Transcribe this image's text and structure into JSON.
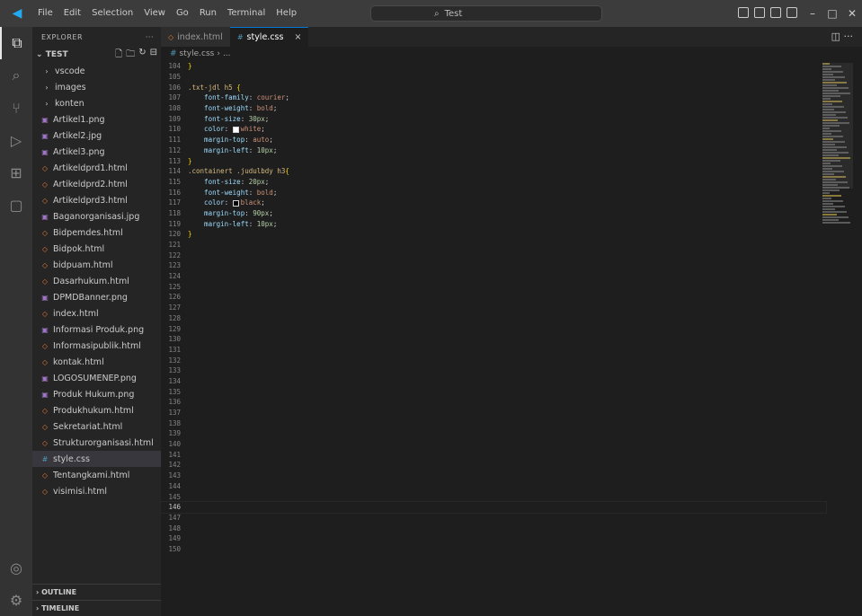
{
  "titlebar": {
    "logo": "◀",
    "menu": [
      "File",
      "Edit",
      "Selection",
      "View",
      "Go",
      "Run",
      "Terminal",
      "Help"
    ],
    "search": "Test",
    "nav_back": "←",
    "nav_forward": "→"
  },
  "activitybar": {
    "icons": [
      "explorer-icon",
      "search-icon",
      "source-control-icon",
      "run-debug-icon",
      "extensions-icon",
      "remote-explorer-icon"
    ],
    "bottom_icons": [
      "accounts-icon",
      "settings-gear-icon"
    ]
  },
  "sidebar": {
    "title": "EXPLORER",
    "more": "···",
    "root": "TEST",
    "items": [
      {
        "label": "vscode",
        "type": "folder"
      },
      {
        "label": "images",
        "type": "folder"
      },
      {
        "label": "konten",
        "type": "folder"
      },
      {
        "label": "Artikel1.png",
        "type": "img"
      },
      {
        "label": "Artikel2.jpg",
        "type": "img"
      },
      {
        "label": "Artikel3.png",
        "type": "img"
      },
      {
        "label": "Artikeldprd1.html",
        "type": "html"
      },
      {
        "label": "Artikeldprd2.html",
        "type": "html"
      },
      {
        "label": "Artikeldprd3.html",
        "type": "html"
      },
      {
        "label": "Baganorganisasi.jpg",
        "type": "img"
      },
      {
        "label": "Bidpemdes.html",
        "type": "html"
      },
      {
        "label": "Bidpok.html",
        "type": "html"
      },
      {
        "label": "bidpuam.html",
        "type": "html"
      },
      {
        "label": "Dasarhukum.html",
        "type": "html"
      },
      {
        "label": "DPMDBanner.png",
        "type": "img"
      },
      {
        "label": "index.html",
        "type": "html"
      },
      {
        "label": "Informasi Produk.png",
        "type": "img"
      },
      {
        "label": "Informasipublik.html",
        "type": "html"
      },
      {
        "label": "kontak.html",
        "type": "html"
      },
      {
        "label": "LOGOSUMENEP.png",
        "type": "img"
      },
      {
        "label": "Produk Hukum.png",
        "type": "img"
      },
      {
        "label": "Produkhukum.html",
        "type": "html"
      },
      {
        "label": "Sekretariat.html",
        "type": "html"
      },
      {
        "label": "Strukturorganisasi.html",
        "type": "html"
      },
      {
        "label": "style.css",
        "type": "css",
        "selected": true
      },
      {
        "label": "Tentangkami.html",
        "type": "html"
      },
      {
        "label": "visimisi.html",
        "type": "html"
      }
    ],
    "outline": "OUTLINE",
    "timeline": "TIMELINE"
  },
  "editor": {
    "tabs": [
      {
        "label": "index.html",
        "type": "html",
        "active": false
      },
      {
        "label": "style.css",
        "type": "css",
        "active": true,
        "close": "×"
      }
    ],
    "breadcrumb": [
      "style.css",
      "..."
    ],
    "actions": "◫ ···",
    "current_line": 146,
    "lines": [
      {
        "n": "104",
        "tokens": [
          [
            "t-brace",
            "}"
          ]
        ]
      },
      {
        "n": "105",
        "tokens": []
      },
      {
        "n": "106",
        "tokens": [
          [
            "t-sel",
            ".txt-jdl h5 "
          ],
          [
            "t-brace",
            "{"
          ]
        ]
      },
      {
        "n": "107",
        "tokens": [
          [
            "t-prop",
            "    font-family"
          ],
          [
            "t-punc",
            ": "
          ],
          [
            "t-val",
            "courier"
          ],
          [
            "t-punc",
            ";"
          ]
        ]
      },
      {
        "n": "108",
        "tokens": [
          [
            "t-prop",
            "    font-weight"
          ],
          [
            "t-punc",
            ": "
          ],
          [
            "t-val",
            "bold"
          ],
          [
            "t-punc",
            ";"
          ]
        ]
      },
      {
        "n": "109",
        "tokens": [
          [
            "t-prop",
            "    font-size"
          ],
          [
            "t-punc",
            ": "
          ],
          [
            "t-num",
            "30px"
          ],
          [
            "t-punc",
            ";"
          ]
        ]
      },
      {
        "n": "110",
        "tokens": [
          [
            "t-prop",
            "    color"
          ],
          [
            "t-punc",
            ": "
          ],
          [
            "swatch-white",
            ""
          ],
          [
            "t-val",
            "white"
          ],
          [
            "t-punc",
            ";"
          ]
        ]
      },
      {
        "n": "111",
        "tokens": [
          [
            "t-prop",
            "    margin-top"
          ],
          [
            "t-punc",
            ": "
          ],
          [
            "t-val",
            "auto"
          ],
          [
            "t-punc",
            ";"
          ]
        ]
      },
      {
        "n": "112",
        "tokens": [
          [
            "t-prop",
            "    margin-left"
          ],
          [
            "t-punc",
            ": "
          ],
          [
            "t-num",
            "10px"
          ],
          [
            "t-punc",
            ";"
          ]
        ]
      },
      {
        "n": "113",
        "tokens": [
          [
            "t-brace",
            "}"
          ]
        ]
      },
      {
        "n": "114",
        "tokens": [
          [
            "t-sel",
            ".containert .judulbdy h3"
          ],
          [
            "t-brace",
            "{"
          ]
        ]
      },
      {
        "n": "115",
        "tokens": [
          [
            "t-prop",
            "    font-size"
          ],
          [
            "t-punc",
            ": "
          ],
          [
            "t-num",
            "20px"
          ],
          [
            "t-punc",
            ";"
          ]
        ]
      },
      {
        "n": "116",
        "tokens": [
          [
            "t-prop",
            "    font-weight"
          ],
          [
            "t-punc",
            ": "
          ],
          [
            "t-val",
            "bold"
          ],
          [
            "t-punc",
            ";"
          ]
        ]
      },
      {
        "n": "117",
        "tokens": [
          [
            "t-prop",
            "    color"
          ],
          [
            "t-punc",
            ": "
          ],
          [
            "swatch-black",
            ""
          ],
          [
            "t-val",
            "black"
          ],
          [
            "t-punc",
            ";"
          ]
        ]
      },
      {
        "n": "118",
        "tokens": [
          [
            "t-prop",
            "    margin-top"
          ],
          [
            "t-punc",
            ": "
          ],
          [
            "t-num",
            "90px"
          ],
          [
            "t-punc",
            ";"
          ]
        ]
      },
      {
        "n": "119",
        "tokens": [
          [
            "t-prop",
            "    margin-left"
          ],
          [
            "t-punc",
            ": "
          ],
          [
            "t-num",
            "10px"
          ],
          [
            "t-punc",
            ";"
          ]
        ]
      },
      {
        "n": "120",
        "tokens": [
          [
            "t-brace",
            "}"
          ]
        ]
      },
      {
        "n": "121",
        "tokens": []
      },
      {
        "n": "122",
        "tokens": []
      },
      {
        "n": "123",
        "tokens": []
      },
      {
        "n": "124",
        "tokens": []
      },
      {
        "n": "125",
        "tokens": []
      },
      {
        "n": "126",
        "tokens": []
      },
      {
        "n": "127",
        "tokens": []
      },
      {
        "n": "128",
        "tokens": []
      },
      {
        "n": "129",
        "tokens": []
      },
      {
        "n": "130",
        "tokens": []
      },
      {
        "n": "131",
        "tokens": []
      },
      {
        "n": "132",
        "tokens": []
      },
      {
        "n": "133",
        "tokens": []
      },
      {
        "n": "134",
        "tokens": []
      },
      {
        "n": "135",
        "tokens": []
      },
      {
        "n": "136",
        "tokens": []
      },
      {
        "n": "137",
        "tokens": []
      },
      {
        "n": "138",
        "tokens": []
      },
      {
        "n": "139",
        "tokens": []
      },
      {
        "n": "140",
        "tokens": []
      },
      {
        "n": "141",
        "tokens": []
      },
      {
        "n": "142",
        "tokens": []
      },
      {
        "n": "143",
        "tokens": []
      },
      {
        "n": "144",
        "tokens": []
      },
      {
        "n": "145",
        "tokens": []
      },
      {
        "n": "146",
        "tokens": []
      },
      {
        "n": "147",
        "tokens": []
      },
      {
        "n": "148",
        "tokens": []
      },
      {
        "n": "149",
        "tokens": []
      },
      {
        "n": "150",
        "tokens": []
      }
    ]
  },
  "colors": {
    "accent": "#0078d4",
    "titlebar": "#3c3c3c",
    "activitybar": "#333333",
    "sidebar": "#252526",
    "editor": "#1e1e1e"
  }
}
